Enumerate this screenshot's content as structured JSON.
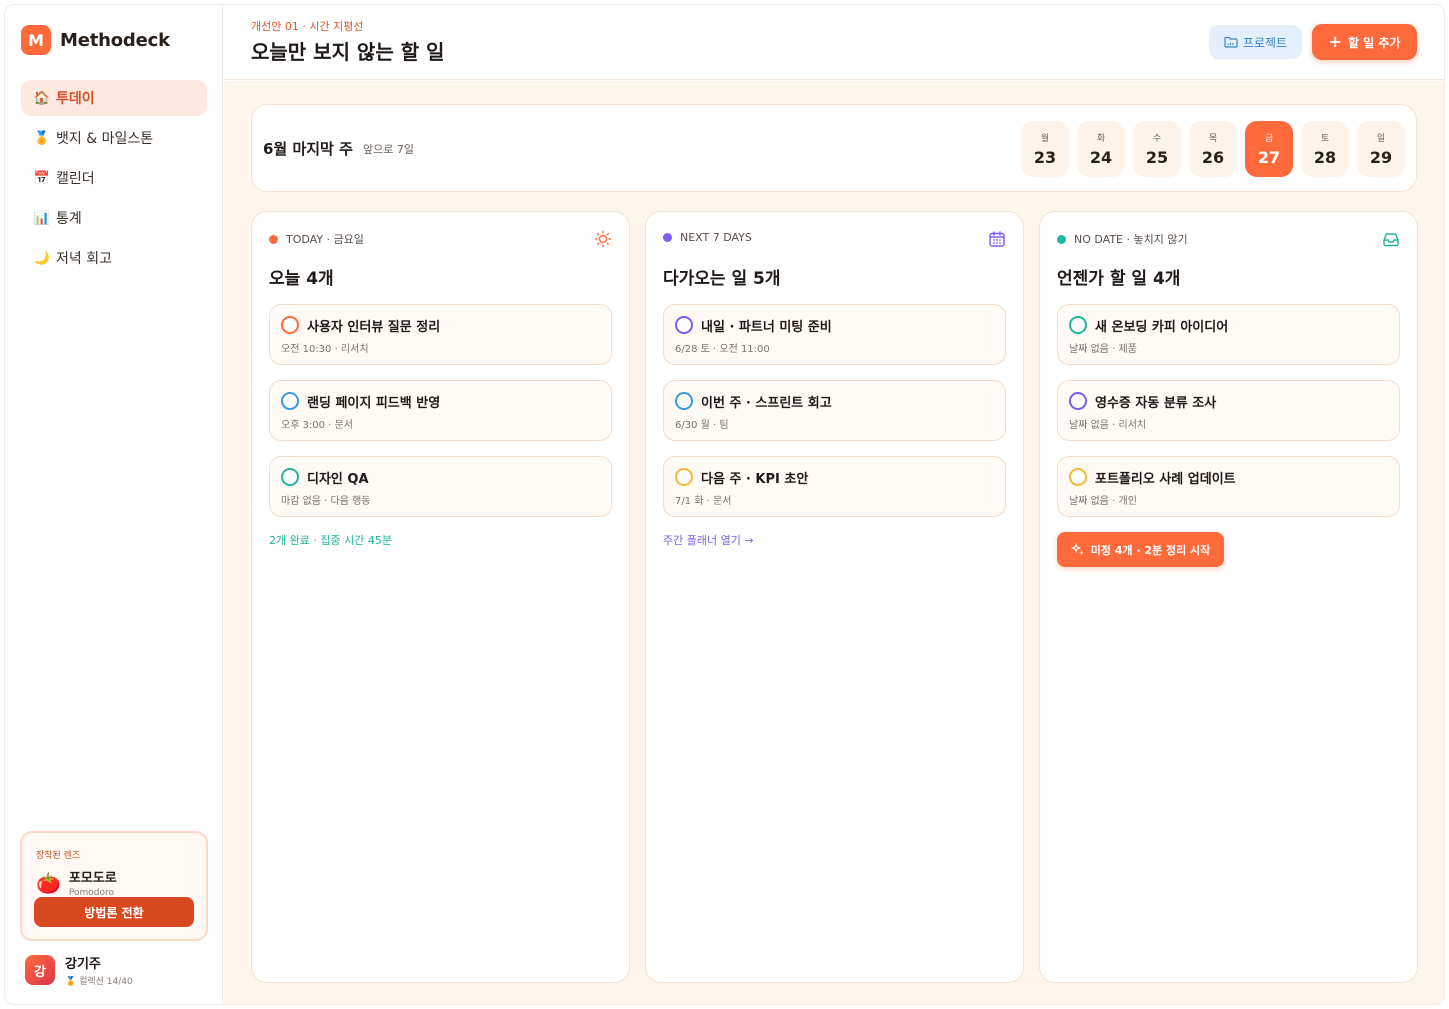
{
  "brand": {
    "logo_letter": "M",
    "name": "Methodeck"
  },
  "nav": [
    {
      "icon": "🏠",
      "label": "투데이"
    },
    {
      "icon": "🏅",
      "label": "뱃지 & 마일스톤"
    },
    {
      "icon": "📅",
      "label": "캘린더"
    },
    {
      "icon": "📊",
      "label": "통계"
    },
    {
      "icon": "🌙",
      "label": "저녁 회고"
    }
  ],
  "lens": {
    "caption": "장착된 렌즈",
    "emoji": "🍅",
    "title": "포모도로",
    "subtitle": "Pomodoro",
    "button": "방법론 전환"
  },
  "user": {
    "initial": "강",
    "name": "강기주",
    "sub": "🏅 컬렉션 14/40"
  },
  "header": {
    "eyebrow": "개선안 01 · 시간 지평선",
    "title": "오늘만 보지 않는 할 일",
    "project_button": "프로젝트",
    "add_button": "할 일 추가"
  },
  "week": {
    "title": "6월 마지막 주",
    "subtitle": "앞으로 7일",
    "days": [
      {
        "name": "월",
        "num": "23"
      },
      {
        "name": "화",
        "num": "24"
      },
      {
        "name": "수",
        "num": "25"
      },
      {
        "name": "목",
        "num": "26"
      },
      {
        "name": "금",
        "num": "27"
      },
      {
        "name": "토",
        "num": "28"
      },
      {
        "name": "일",
        "num": "29"
      }
    ],
    "active_index": 4
  },
  "columns": {
    "today": {
      "label": "TODAY · 금요일",
      "title": "오늘 4개",
      "dot_color": "#ff6a3d",
      "tasks": [
        {
          "title": "사용자 인터뷰 질문 정리",
          "meta": "오전 10:30 · 리서치",
          "color": "#ff6a3d"
        },
        {
          "title": "랜딩 페이지 피드백 반영",
          "meta": "오후 3:00 · 문서",
          "color": "#3b9ad9"
        },
        {
          "title": "디자인 QA",
          "meta": "마감 없음 · 다음 행동",
          "color": "#1fb59a"
        }
      ],
      "footer": "2개 완료 · 집중 시간 45분",
      "footer_color": "#1fb59a"
    },
    "next": {
      "label": "NEXT 7 DAYS",
      "title": "다가오는 일 5개",
      "dot_color": "#7b5cf0",
      "tasks": [
        {
          "title": "내일 · 파트너 미팅 준비",
          "meta": "6/28 토 · 오전 11:00",
          "color": "#7b5cf0"
        },
        {
          "title": "이번 주 · 스프린트 회고",
          "meta": "6/30 월 · 팀",
          "color": "#3b9ad9"
        },
        {
          "title": "다음 주 · KPI 초안",
          "meta": "7/1 화 · 문서",
          "color": "#f5b73b"
        }
      ],
      "footer": "주간 플래너 열기 →",
      "footer_color": "#7b5cf0"
    },
    "nodate": {
      "label": "NO DATE · 놓치지 않기",
      "title": "언젠가 할 일 4개",
      "dot_color": "#1fb59a",
      "tasks": [
        {
          "title": "새 온보딩 카피 아이디어",
          "meta": "날짜 없음 · 제품",
          "color": "#1fb59a"
        },
        {
          "title": "영수증 자동 분류 조사",
          "meta": "날짜 없음 · 리서치",
          "color": "#7b5cf0"
        },
        {
          "title": "포트폴리오 사례 업데이트",
          "meta": "날짜 없음 · 개인",
          "color": "#f5b73b"
        }
      ],
      "cleanup_button": "미정 4개 · 2분 정리 시작"
    }
  }
}
